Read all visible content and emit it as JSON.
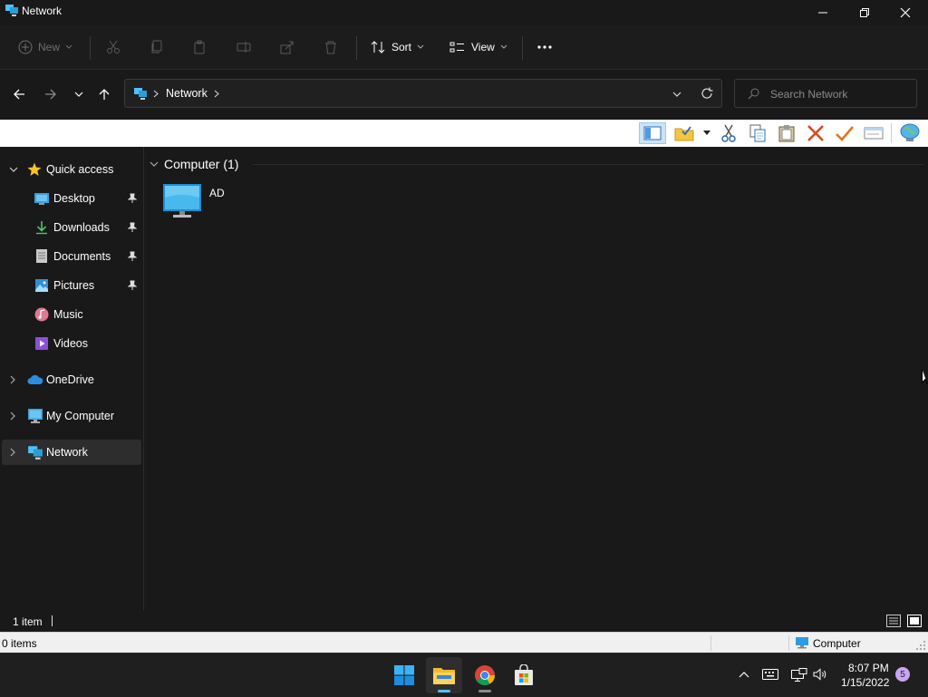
{
  "window": {
    "title": "Network"
  },
  "command_bar": {
    "new_label": "New",
    "sort_label": "Sort",
    "view_label": "View",
    "more_label": "..."
  },
  "address": {
    "location": "Network",
    "search_placeholder": "Search Network"
  },
  "nav_pane": {
    "quick_access": "Quick access",
    "items": [
      {
        "label": "Desktop"
      },
      {
        "label": "Downloads"
      },
      {
        "label": "Documents"
      },
      {
        "label": "Pictures"
      },
      {
        "label": "Music"
      },
      {
        "label": "Videos"
      }
    ],
    "onedrive": "OneDrive",
    "my_computer": "My Computer",
    "network": "Network"
  },
  "content": {
    "group_header": "Computer (1)",
    "items": [
      {
        "label": "AD"
      }
    ]
  },
  "status": {
    "item_count": "1 item",
    "legacy_items": "0 items",
    "legacy_zone": "Computer"
  },
  "taskbar": {
    "time": "8:07 PM",
    "date": "1/15/2022",
    "notification_count": "5"
  },
  "colors": {
    "accent": "#4cc2ff",
    "background": "#191919",
    "selected": "#2d2d2d"
  }
}
